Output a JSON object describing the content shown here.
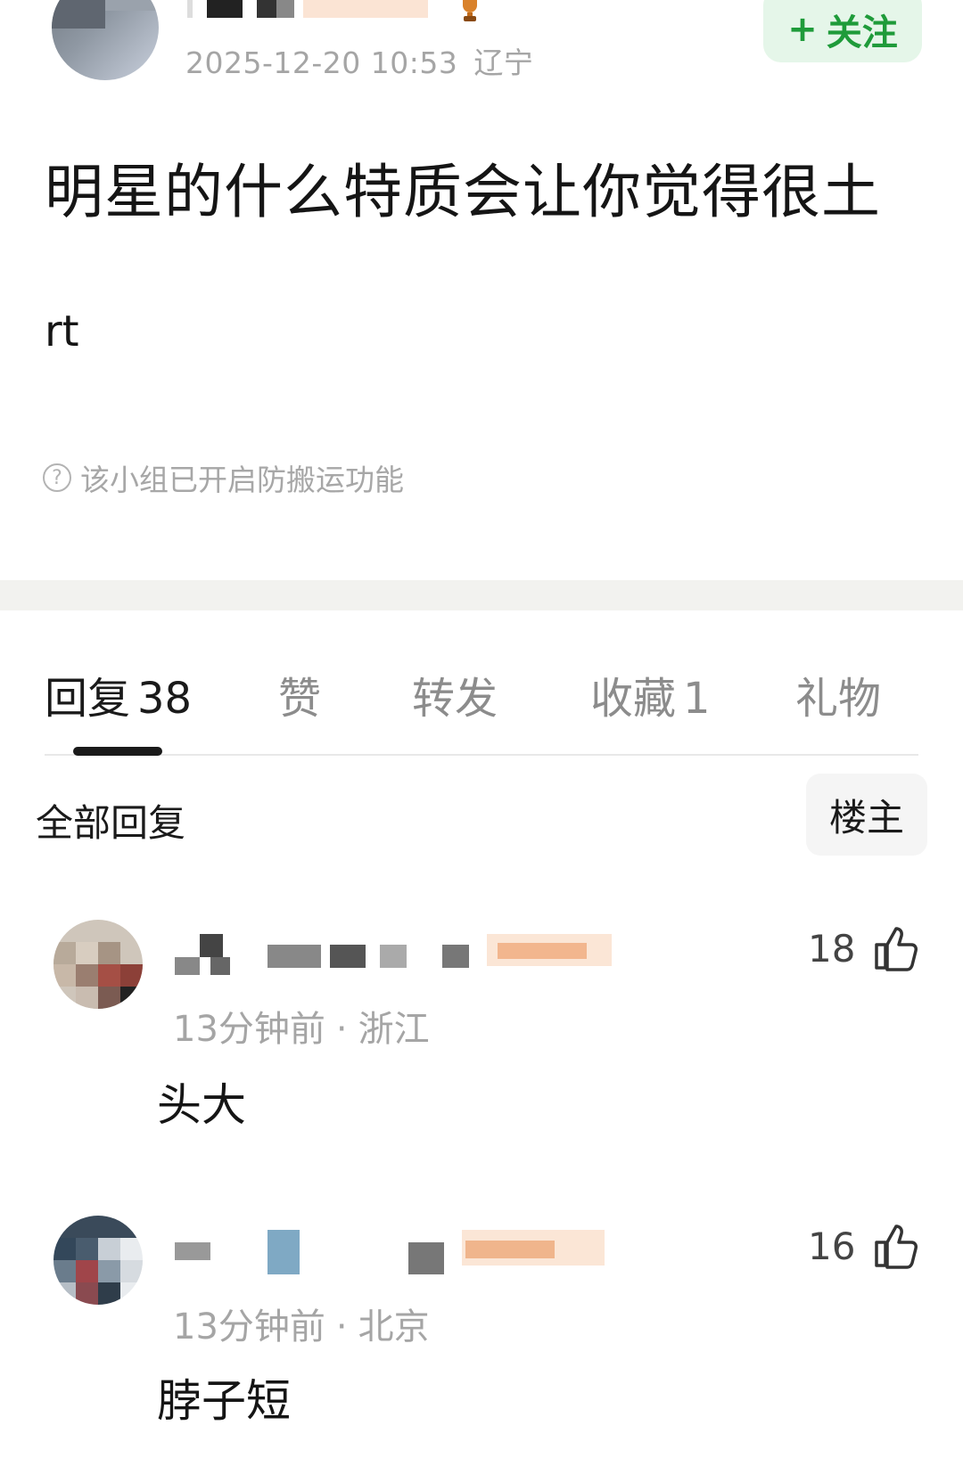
{
  "post": {
    "time": "2025-12-20 10:53",
    "location": "辽宁",
    "follow_plus": "+",
    "follow_label": "关注",
    "title": "明星的什么特质会让你觉得很土",
    "body": "rt",
    "notice_text": "该小组已开启防搬运功能"
  },
  "tabs": [
    {
      "label": "回复",
      "count": "38"
    },
    {
      "label": "赞",
      "count": ""
    },
    {
      "label": "转发",
      "count": ""
    },
    {
      "label": "收藏",
      "count": "1"
    },
    {
      "label": "礼物",
      "count": ""
    }
  ],
  "replies": {
    "filter_label": "全部回复",
    "op_button": "楼主"
  },
  "comments": [
    {
      "time": "13分钟前",
      "separator": "·",
      "location": "浙江",
      "text": "头大",
      "likes": "18"
    },
    {
      "time": "13分钟前",
      "separator": "·",
      "location": "北京",
      "text": "脖子短",
      "likes": "16"
    }
  ],
  "colors": {
    "follow_bg": "#e5f6e9",
    "follow_text": "#1f9b3a",
    "muted_text": "#a5a5a5",
    "section_band": "#f2f2ef"
  },
  "icons": {
    "notice": "question-circle-icon",
    "like": "thumbs-up-icon"
  }
}
